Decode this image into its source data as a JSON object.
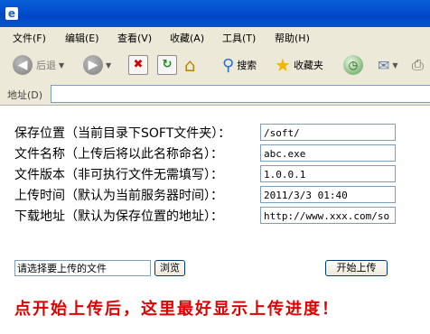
{
  "menu": [
    "文件(F)",
    "编辑(E)",
    "查看(V)",
    "收藏(A)",
    "工具(T)",
    "帮助(H)"
  ],
  "toolbar": {
    "back_label": "后退",
    "search_label": "搜索",
    "favorites_label": "收藏夹"
  },
  "address": {
    "label": "地址(D)"
  },
  "form": {
    "rows": [
      {
        "label": "保存位置（当前目录下SOFT文件夹）：",
        "value": "/soft/"
      },
      {
        "label": "文件名称（上传后将以此名称命名）：",
        "value": "abc.exe"
      },
      {
        "label": "文件版本（非可执行文件无需填写）：",
        "value": "1.0.0.1"
      },
      {
        "label": "上传时间（默认为当前服务器时间）：",
        "value": "2011/3/3 01:40"
      },
      {
        "label": "下载地址（默认为保存位置的地址）：",
        "value": "http://www.xxx.com/so"
      }
    ],
    "file_placeholder": "请选择要上传的文件",
    "browse_label": "浏览",
    "upload_label": "开始上传"
  },
  "message": "点开始上传后，这里最好显示上传进度！"
}
